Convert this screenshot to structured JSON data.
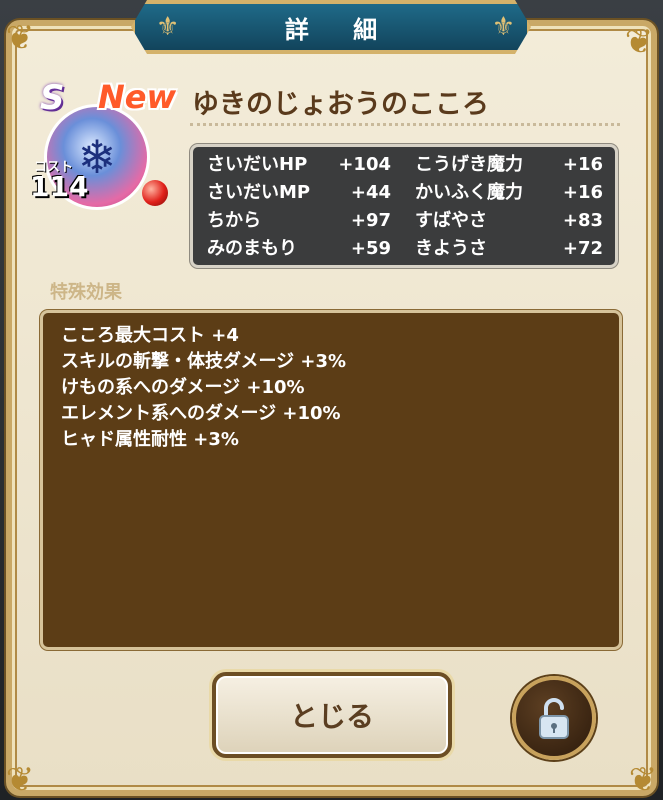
{
  "dialog": {
    "title": "詳 細",
    "close_label": "とじる"
  },
  "item": {
    "rank": "S",
    "badge": "New",
    "name": "ゆきのじょおうのこころ",
    "cost_label": "コスト",
    "cost_value": "114"
  },
  "stats": [
    {
      "label": "さいだいHP",
      "value": "+104"
    },
    {
      "label": "こうげき魔力",
      "value": "+16"
    },
    {
      "label": "さいだいMP",
      "value": "+44"
    },
    {
      "label": "かいふく魔力",
      "value": "+16"
    },
    {
      "label": "ちから",
      "value": "+97"
    },
    {
      "label": "すばやさ",
      "value": "+83"
    },
    {
      "label": "みのまもり",
      "value": "+59"
    },
    {
      "label": "きようさ",
      "value": "+72"
    }
  ],
  "effects": {
    "heading": "特殊効果",
    "lines": [
      "こころ最大コスト +4",
      "スキルの斬撃・体技ダメージ +3%",
      "けもの系へのダメージ +10%",
      "エレメント系へのダメージ +10%",
      "ヒャド属性耐性 +3%"
    ]
  },
  "icons": {
    "monster": "snow-queen-monster-icon",
    "element_orb": "red-orb-icon",
    "lock": "unlocked-padlock-icon"
  },
  "colors": {
    "panel_bg": "#f3ecd9",
    "title_plate": "#1f6a88",
    "stats_bg": "#3b3c3d",
    "effects_bg": "#5c3d16",
    "name_text": "#5a3a1c"
  }
}
